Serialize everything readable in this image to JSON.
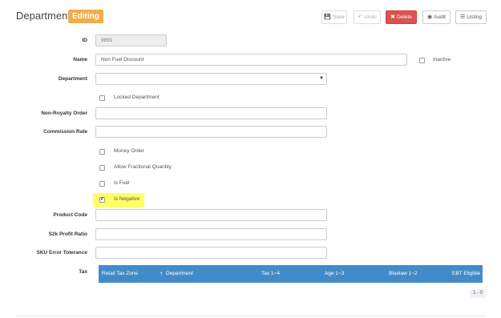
{
  "header": {
    "title": "Department",
    "status_badge": "Editing"
  },
  "toolbar": {
    "save": {
      "label": "Save",
      "icon": "save-icon"
    },
    "undo": {
      "label": "Undo",
      "icon": "undo-icon"
    },
    "delete": {
      "label": "Delete",
      "icon": "close-icon"
    },
    "audit": {
      "label": "Audit",
      "icon": "eye-icon"
    },
    "listing": {
      "label": "Listing",
      "icon": "list-icon"
    }
  },
  "form": {
    "id": {
      "label": "ID",
      "value": "9891"
    },
    "name": {
      "label": "Name",
      "value": "Non Fuel Discount"
    },
    "inactive": {
      "label": "Inactive",
      "checked": false
    },
    "department": {
      "label": "Department",
      "value": ""
    },
    "locked_department": {
      "label": "Locked Department",
      "checked": false
    },
    "non_royalty_order": {
      "label": "Non-Royalty Order",
      "value": ""
    },
    "commission_rate": {
      "label": "Commission Rate",
      "value": ""
    },
    "money_order": {
      "label": "Money Order",
      "checked": false
    },
    "allow_fractional_quantity": {
      "label": "Allow Fractional Quantity",
      "checked": false
    },
    "is_fuel": {
      "label": "Is Fuel",
      "checked": false
    },
    "is_negative": {
      "label": "Is Negative",
      "checked": true
    },
    "product_code": {
      "label": "Product Code",
      "value": ""
    },
    "s2k_profit_ratio": {
      "label": "S2k Profit Ratio",
      "value": ""
    },
    "sku_error_tolerance": {
      "label": "SKU Error Tolerance",
      "value": ""
    },
    "tax": {
      "label": "Tax"
    }
  },
  "tax_table": {
    "columns": [
      "Retail Tax Zone",
      "Department",
      "Tax 1~4",
      "Age 1~3",
      "Bluelaw 1~2",
      "EBT Eligible"
    ],
    "sort_indicator": "↑",
    "pager": "1 - 0"
  },
  "colors": {
    "badge": "#f0ad4e",
    "delete": "#d9534f",
    "table_header": "#428bca",
    "highlight": "#ffff66"
  }
}
